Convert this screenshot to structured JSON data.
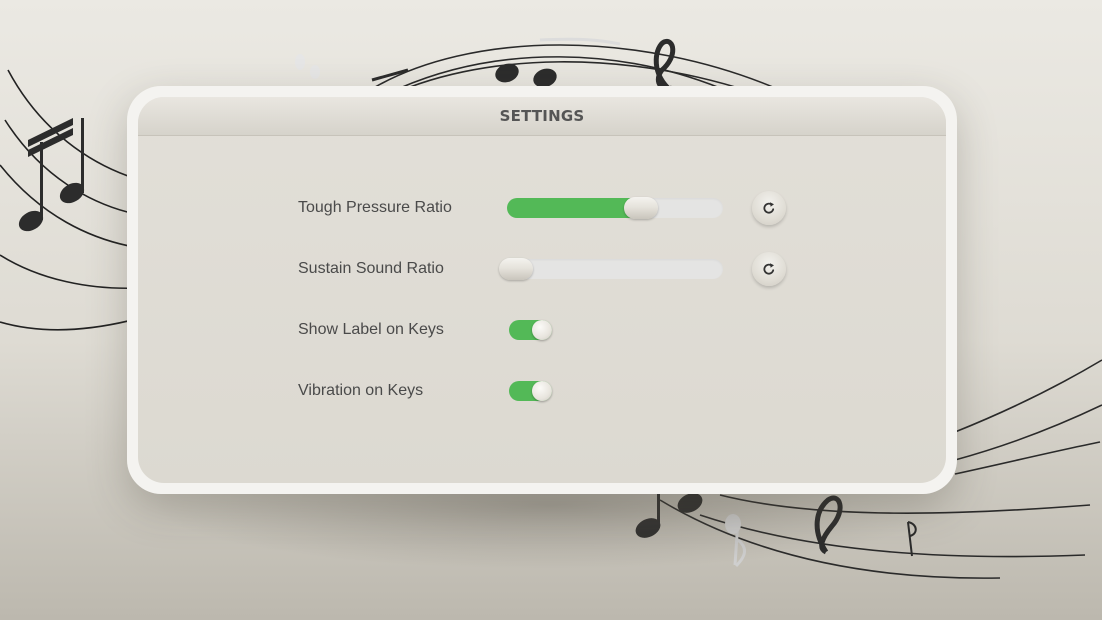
{
  "dialog": {
    "title": "SETTINGS"
  },
  "settings": [
    {
      "type": "slider",
      "label": "Tough Pressure Ratio",
      "value_fraction": 0.62
    },
    {
      "type": "slider",
      "label": "Sustain Sound Ratio",
      "value_fraction": 0.0
    },
    {
      "type": "toggle",
      "label": "Show Label on Keys",
      "on": true
    },
    {
      "type": "toggle",
      "label": "Vibration on Keys",
      "on": true
    }
  ],
  "icons": {
    "reset": "reset-icon",
    "background": "music-notes-staff"
  },
  "colors": {
    "accent_green": "#53b957",
    "track": "#e4e4e3",
    "label_text": "#4a4a4a",
    "title_text": "#555555"
  }
}
